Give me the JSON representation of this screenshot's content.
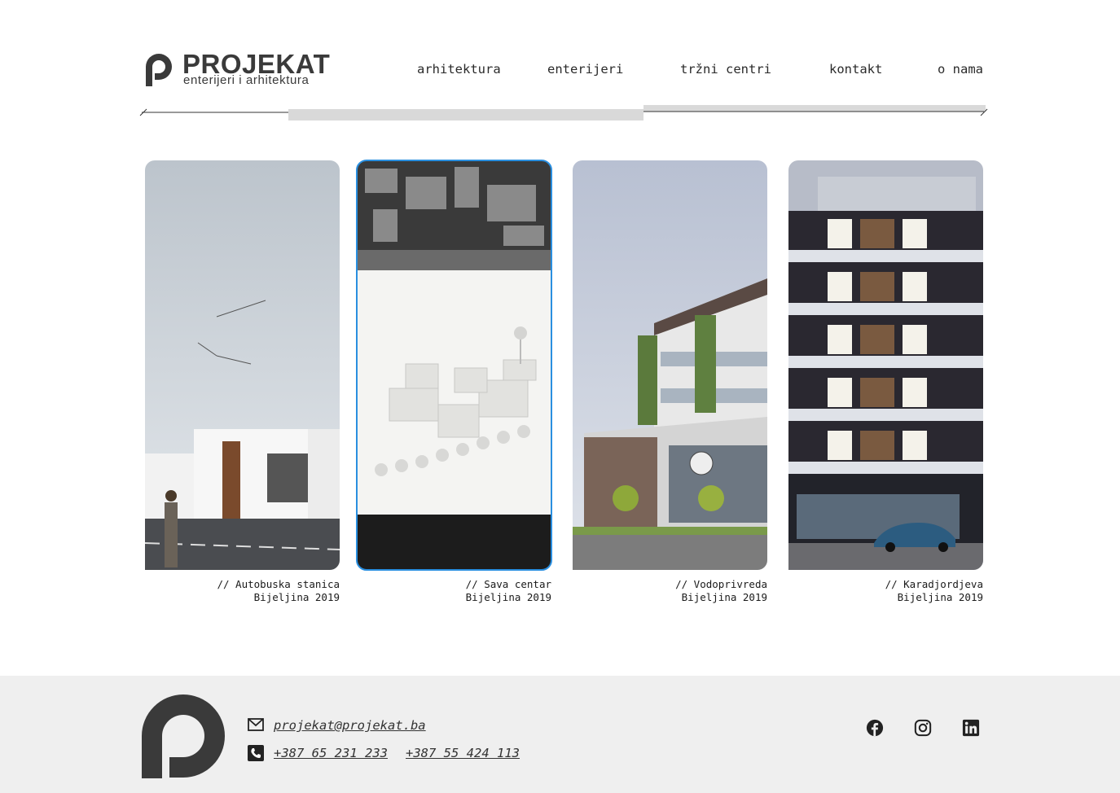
{
  "brand": {
    "name": "PROJEKAT",
    "tagline": "enterijeri i arhitektura",
    "color": "#3a3a3a"
  },
  "nav": {
    "items": [
      {
        "label": "arhitektura"
      },
      {
        "label": "enterijeri"
      },
      {
        "label": "tržni centri"
      },
      {
        "label": "kontakt"
      },
      {
        "label": "o nama"
      }
    ]
  },
  "projects": [
    {
      "title": "// Autobuska stanica",
      "subtitle": "Bijeljina 2019",
      "image": "bus-station-render"
    },
    {
      "title": "// Sava centar",
      "subtitle": "Bijeljina 2019",
      "image": "architectural-model-photo",
      "selected": true
    },
    {
      "title": "// Vodoprivreda",
      "subtitle": "Bijeljina 2019",
      "image": "office-building-render"
    },
    {
      "title": "// Karadjordjeva",
      "subtitle": "Bijeljina 2019",
      "image": "residential-tower-render"
    }
  ],
  "footer": {
    "email": "projekat@projekat.ba",
    "phone_1": "+387 65 231 233",
    "phone_2": "+387 55 424 113",
    "icons": [
      "mail-icon",
      "phone-icon",
      "facebook-icon",
      "instagram-icon",
      "linkedin-icon"
    ]
  },
  "colors": {
    "accent": "#2a8fe0",
    "footer_bg": "#efefef",
    "text": "#222222"
  }
}
